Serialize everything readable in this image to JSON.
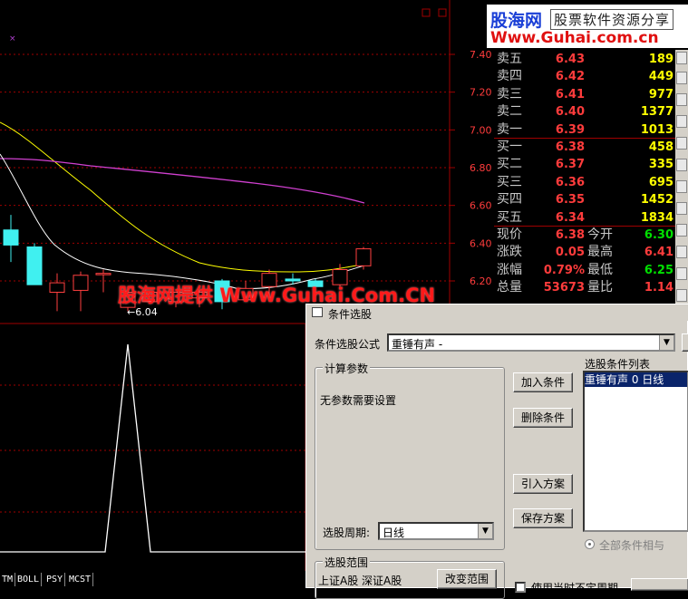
{
  "chart_data": {
    "type": "candlestick",
    "price_ticks": [
      "7.40",
      "7.20",
      "7.00",
      "6.80",
      "6.60",
      "6.40",
      "6.20"
    ],
    "low_marker": "←6.04",
    "indicator_tabs": [
      "TM",
      "BOLL",
      "PSY",
      "MCST"
    ]
  },
  "logo": {
    "name": "股海网",
    "slogan": "股票软件资源分享",
    "url": "Www.Guhai.com.cn"
  },
  "watermark": "股海网提供 Www.Guhai.Com.CN",
  "quotes": {
    "asks": [
      {
        "label": "卖五",
        "price": "6.43",
        "vol": "189"
      },
      {
        "label": "卖四",
        "price": "6.42",
        "vol": "449"
      },
      {
        "label": "卖三",
        "price": "6.41",
        "vol": "977"
      },
      {
        "label": "卖二",
        "price": "6.40",
        "vol": "1377"
      },
      {
        "label": "卖一",
        "price": "6.39",
        "vol": "1013"
      }
    ],
    "bids": [
      {
        "label": "买一",
        "price": "6.38",
        "vol": "458"
      },
      {
        "label": "买二",
        "price": "6.37",
        "vol": "335"
      },
      {
        "label": "买三",
        "price": "6.36",
        "vol": "695"
      },
      {
        "label": "买四",
        "price": "6.35",
        "vol": "1452"
      },
      {
        "label": "买五",
        "price": "6.34",
        "vol": "1834"
      }
    ],
    "stats": [
      {
        "l1": "现价",
        "v1": "6.38",
        "l2": "今开",
        "v2": "6.30",
        "c2": "#00e000"
      },
      {
        "l1": "涨跌",
        "v1": "0.05",
        "l2": "最高",
        "v2": "6.41",
        "c2": "#ff3c3c"
      },
      {
        "l1": "涨幅",
        "v1": "0.79%",
        "l2": "最低",
        "v2": "6.25",
        "c2": "#00e000"
      },
      {
        "l1": "总量",
        "v1": "53673",
        "l2": "量比",
        "v2": "1.14",
        "c2": "#ff3c3c"
      }
    ]
  },
  "dialog": {
    "title": "条件选股",
    "formula_label": "条件选股公式",
    "formula_value": "重锤有声 -",
    "params_group": "计算参数",
    "params_text": "无参数需要设置",
    "period_label": "选股周期:",
    "period_value": "日线",
    "btn_add": "加入条件",
    "btn_delete": "删除条件",
    "btn_import": "引入方案",
    "btn_save": "保存方案",
    "list_label": "选股条件列表",
    "list_items": [
      "重锤有声  0  日线"
    ],
    "radio_label": "全部条件相与",
    "range_group": "选股范围",
    "range_text": "上证A股 深证A股",
    "btn_change_range": "改变范围",
    "checkbox_label": "使用当时不定周期"
  }
}
